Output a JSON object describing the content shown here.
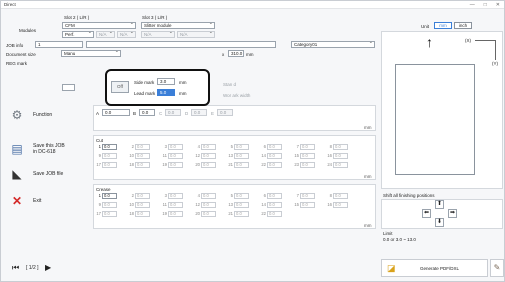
{
  "window": {
    "title": "Direct",
    "min": "—",
    "max": "□",
    "close": "✕"
  },
  "slots": {
    "slot2_label": "Slot 2 ( L/R )",
    "slot3_label": "Slot 3 ( L/R )"
  },
  "modules": {
    "label": "Modules",
    "slot2_module": "CFM",
    "slot2_mode": "Perf.",
    "slot2_na1": "N/A",
    "slot2_na2": "N/A",
    "slot3_module": "Slitter module",
    "slot3_na1": "N/A",
    "slot3_na2": "N/A"
  },
  "job": {
    "info_label": "JOB info",
    "info_value": "1",
    "category": "Category01",
    "doc_size_label": "Document size",
    "doc_size_value": "Manu",
    "doc_size_x": "x",
    "doc_size_h": "310.0",
    "doc_size_unit": "mm",
    "reg_mark_label": "REG mark"
  },
  "popup": {
    "off": "Off",
    "side_mark_label": "Side mark",
    "side_mark_value": "3.0",
    "side_mark_unit": "mm",
    "lead_mark_label": "Lead mark",
    "lead_mark_value": "5.0",
    "lead_mark_unit": "mm",
    "right_top": "Stan  d",
    "right_bottom": "Wor  ark width"
  },
  "function": {
    "label": "Function",
    "perf_a_label": "A",
    "perf_a": "0.0",
    "perf_b_label": "B",
    "perf_b": "0.0",
    "perf_c_label": "C",
    "perf_c": "0.0",
    "perf_d_label": "D",
    "perf_d": "0.0",
    "perf_e_label": "E",
    "perf_e": "0.0",
    "mm": "mm"
  },
  "cut": {
    "label": "Cut",
    "first": "0.0",
    "cell": "0.0",
    "mm": "mm"
  },
  "crease": {
    "label": "Crease",
    "first": "0.0",
    "cell": "0.0",
    "mm": "mm"
  },
  "sidebar": {
    "save_dc": "Save this JOB\nin DC-618",
    "save_file": "Save JOB file",
    "exit": "Exit"
  },
  "pager": {
    "text": "[ 1/2 ]",
    "first": "⏮",
    "next": "▶"
  },
  "right": {
    "unit_label": "Unit",
    "unit_mm": "mm",
    "unit_inch": "inch",
    "x_label": "(X)",
    "y_label": "(Y)",
    "shift_label": "Shift all finishing positions",
    "limit_label": "Limit",
    "limit_value": "0.0 or 3.0 ~ 13.0",
    "generate": "Generate PDF/DXL"
  }
}
